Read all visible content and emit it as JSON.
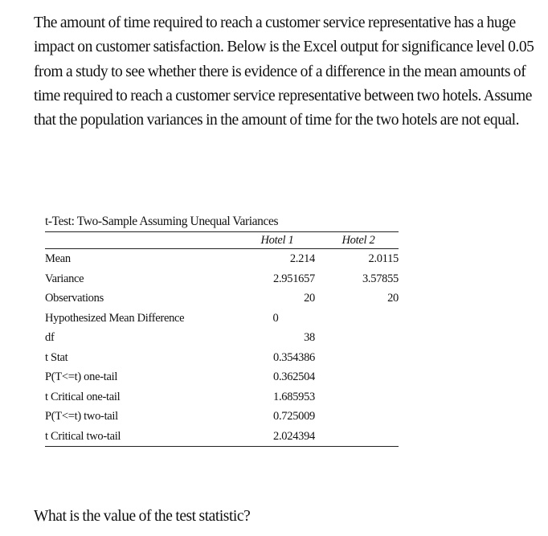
{
  "intro": {
    "text": "The amount of time required to reach a customer service representative has a huge impact on customer satisfaction. Below is the Excel output for significance level 0.05 from a study to see whether there is evidence of a difference in the mean amounts of time required to reach a customer service representative between two hotels. Assume that the population variances in the amount of time for the two hotels are not equal."
  },
  "table": {
    "title": "t-Test: Two-Sample Assuming Unequal Variances",
    "headers": [
      "",
      "Hotel 1",
      "Hotel 2"
    ],
    "rows": [
      {
        "label": "Mean",
        "hotel1": "2.214",
        "hotel2": "2.0115"
      },
      {
        "label": "Variance",
        "hotel1": "2.951657",
        "hotel2": "3.57855"
      },
      {
        "label": "Observations",
        "hotel1": "20",
        "hotel2": "20"
      },
      {
        "label": "Hypothesized Mean Difference",
        "hotel1": "0",
        "hotel2": ""
      },
      {
        "label": "df",
        "hotel1": "38",
        "hotel2": ""
      },
      {
        "label": "t Stat",
        "hotel1": "0.354386",
        "hotel2": ""
      },
      {
        "label": "P(T<=t) one-tail",
        "hotel1": "0.362504",
        "hotel2": ""
      },
      {
        "label": "t Critical one-tail",
        "hotel1": "1.685953",
        "hotel2": ""
      },
      {
        "label": "P(T<=t) two-tail",
        "hotel1": "0.725009",
        "hotel2": ""
      },
      {
        "label": "t Critical two-tail",
        "hotel1": "2.024394",
        "hotel2": ""
      }
    ]
  },
  "question": {
    "text": "What is the value of the test statistic?"
  }
}
